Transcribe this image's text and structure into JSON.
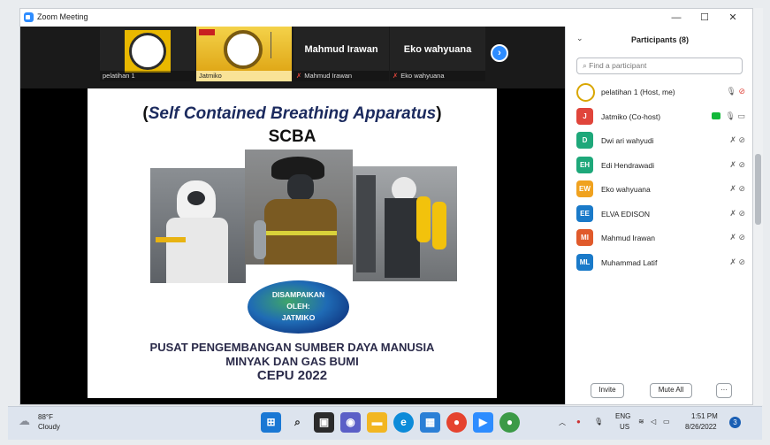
{
  "window": {
    "title": "Zoom Meeting",
    "controls": [
      "—",
      "☐",
      "✕"
    ]
  },
  "strip": {
    "tiles": [
      {
        "name": "pelatihan 1",
        "big": "",
        "muted": false
      },
      {
        "name": "Jatmiko",
        "big": "",
        "muted": false
      },
      {
        "name": "Mahmud Irawan",
        "big": "Mahmud Irawan",
        "muted": true
      },
      {
        "name": "Eko wahyuana",
        "big": "Eko wahyuana",
        "muted": true
      }
    ],
    "next": "›"
  },
  "slide": {
    "title_open": "(",
    "title_italic": "Self Contained Breathing Apparatus",
    "title_close": ")",
    "subtitle": "SCBA",
    "globe_text": [
      "DISAMPAIKAN",
      "OLEH:",
      "JATMIKO"
    ],
    "footer": [
      "PUSAT PENGEMBANGAN SUMBER DAYA MANUSIA",
      "MINYAK DAN GAS BUMI",
      "CEPU 2022"
    ]
  },
  "participants": {
    "title": "Participants (8)",
    "search_placeholder": "Find a participant",
    "list": [
      {
        "initials": "",
        "name": "pelatihan 1 (Host, me)",
        "color": "#ffffff",
        "mic": "on",
        "video": "off"
      },
      {
        "initials": "J",
        "name": "Jatmiko (Co-host)",
        "color": "#e0453b",
        "mic": "on",
        "video": "on",
        "sharing": true
      },
      {
        "initials": "D",
        "name": "Dwi ari wahyudi",
        "color": "#1ea87a",
        "mic": "off",
        "video": "off"
      },
      {
        "initials": "EH",
        "name": "Edi Hendrawadi",
        "color": "#1ea87a",
        "mic": "off",
        "video": "off"
      },
      {
        "initials": "EW",
        "name": "Eko wahyuana",
        "color": "#f0a21f",
        "mic": "off",
        "video": "off"
      },
      {
        "initials": "EE",
        "name": "ELVA EDISON",
        "color": "#1a7ac9",
        "mic": "off",
        "video": "off"
      },
      {
        "initials": "MI",
        "name": "Mahmud Irawan",
        "color": "#e05a2b",
        "mic": "off",
        "video": "off"
      },
      {
        "initials": "ML",
        "name": "Muhammad Latif",
        "color": "#1a7ac9",
        "mic": "off",
        "video": "off"
      }
    ],
    "invite": "Invite",
    "mute_all": "Mute All",
    "more": "···"
  },
  "taskbar": {
    "temp": "88°F",
    "condition": "Cloudy",
    "lang": "ENG",
    "region": "US",
    "time": "1:51 PM",
    "date": "8/26/2022",
    "badge": "3"
  }
}
